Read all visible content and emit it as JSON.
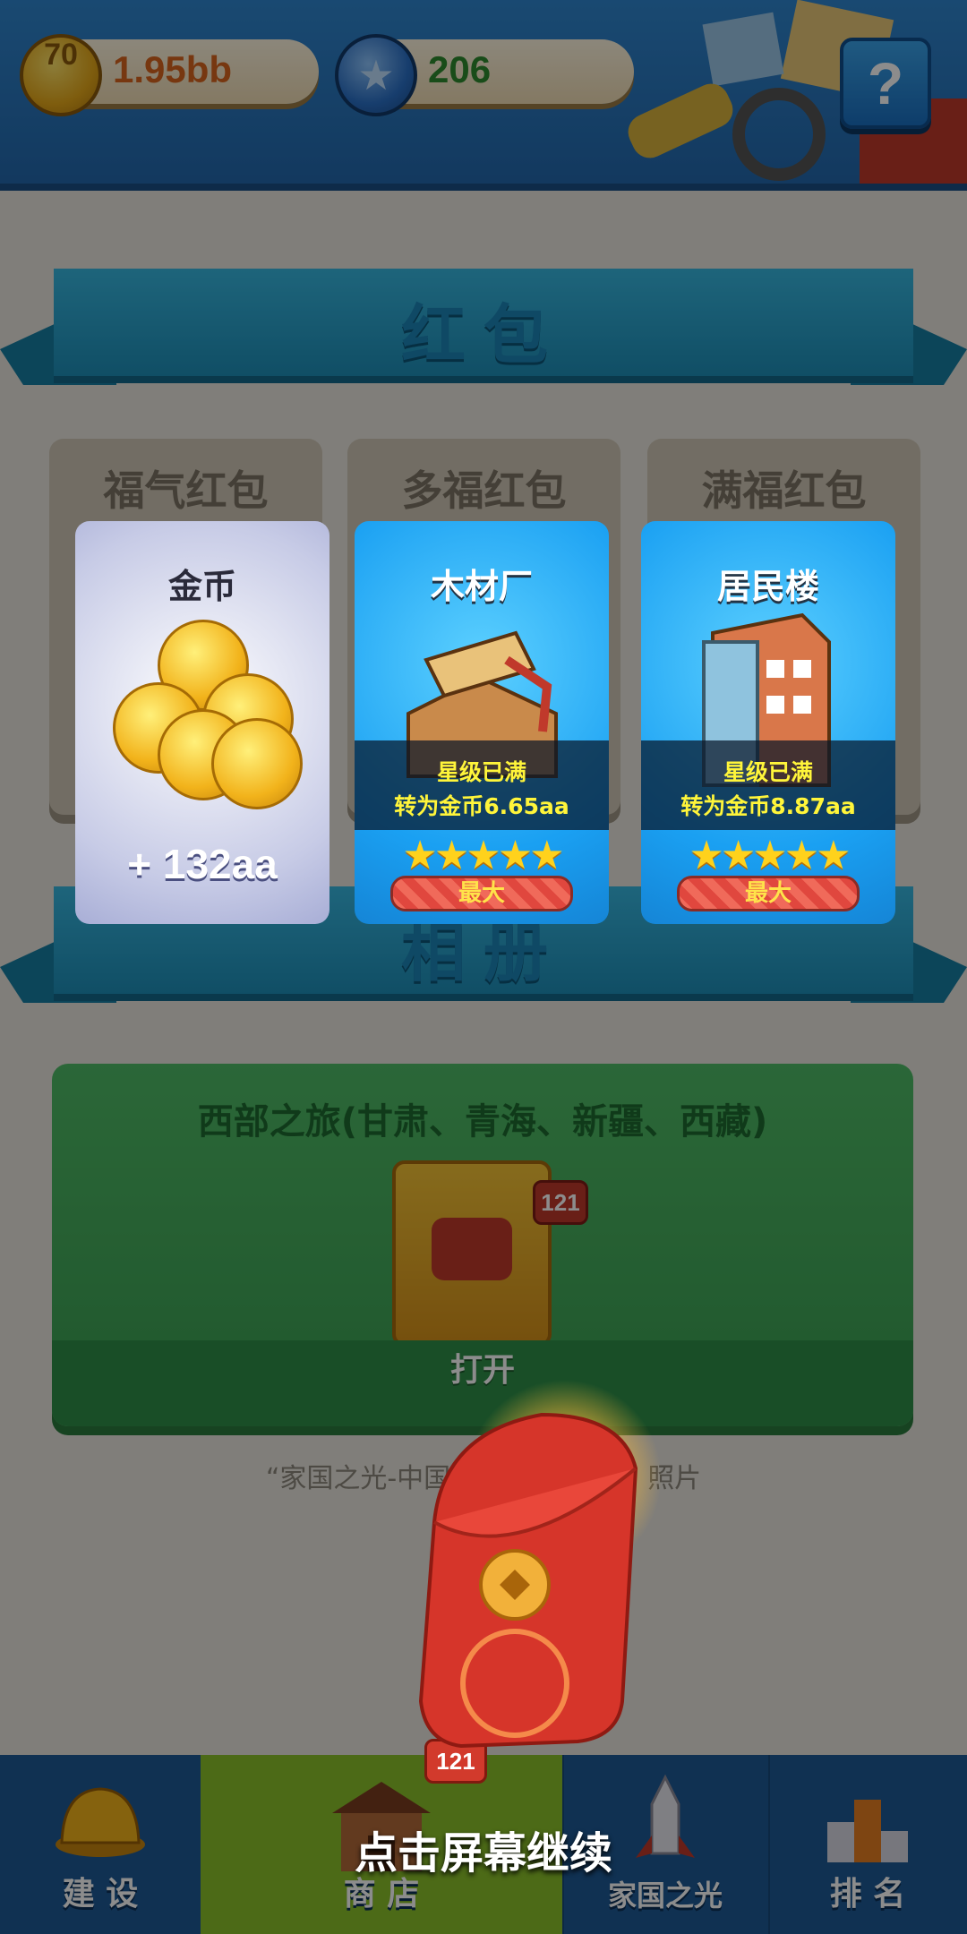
{
  "header": {
    "coins": "1.95bb",
    "coin_icon_text": "70",
    "stars": "206",
    "help": "?"
  },
  "section_redpacket": {
    "title": "红包"
  },
  "columns": [
    "福气红包",
    "多福红包",
    "满福红包"
  ],
  "cards": [
    {
      "name": "金币",
      "amount": "+ 132aa"
    },
    {
      "name": "木材厂",
      "status": "星级已满",
      "convert": "转为金币6.65aa",
      "stars": 5,
      "max_label": "最大"
    },
    {
      "name": "居民楼",
      "status": "星级已满",
      "convert": "转为金币8.87aa",
      "stars": 5,
      "max_label": "最大"
    }
  ],
  "section_album": {
    "title": "相册"
  },
  "album": {
    "title": "西部之旅(甘肃、青海、新疆、西藏)",
    "badge": "121",
    "open_label": "打开"
  },
  "album_caption": "“家国之光-中国",
  "album_caption_tail": "照片",
  "nav": [
    {
      "label": "建 设"
    },
    {
      "label": "商 店",
      "badge": "121"
    },
    {
      "label": "家国之光"
    },
    {
      "label": "排 名"
    }
  ],
  "tap_hint": "点击屏幕继续",
  "colors": {
    "coin_text": "#d9641e",
    "star_text": "#2e8a2e",
    "nav_active": "#8bc22a"
  }
}
